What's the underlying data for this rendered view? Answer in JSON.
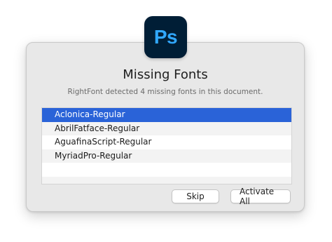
{
  "app_icon": {
    "label": "Ps",
    "background": "#001e36",
    "color": "#31a8ff",
    "icon": "photoshop-app-icon"
  },
  "dialog": {
    "title": "Missing Fonts",
    "message": "RightFont detected 4 missing fonts in this document."
  },
  "fonts": [
    {
      "name": "Aclonica-Regular",
      "selected": true
    },
    {
      "name": "AbrilFatface-Regular",
      "selected": false
    },
    {
      "name": "AguafinaScript-Regular",
      "selected": false
    },
    {
      "name": "MyriadPro-Regular",
      "selected": false
    }
  ],
  "buttons": {
    "skip": "Skip",
    "activate_all": "Activate All"
  },
  "colors": {
    "selection": "#2a63d8",
    "dialog_background": "#e8e8e8"
  }
}
